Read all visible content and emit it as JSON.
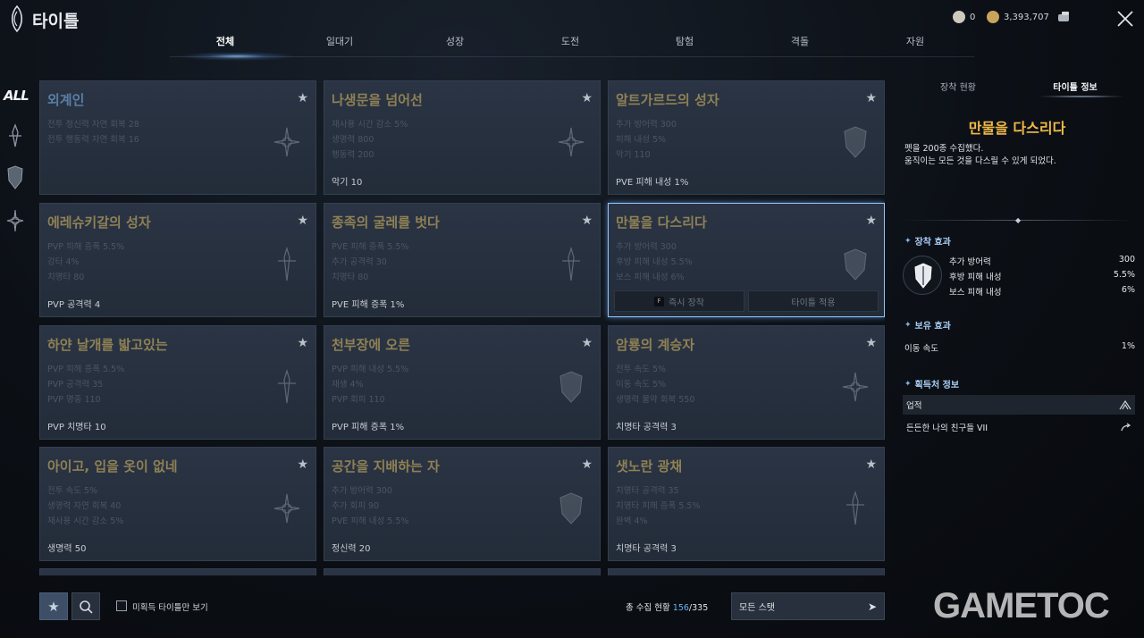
{
  "header": {
    "title": "타이틀",
    "currency_1": "0",
    "currency_2": "3,393,707"
  },
  "tabs": [
    "전체",
    "일대기",
    "성장",
    "도전",
    "탐험",
    "격돌",
    "자원"
  ],
  "active_tab": "전체",
  "rail": {
    "all_label": "ALL"
  },
  "cards": [
    {
      "title": "외계인",
      "stats": [
        "전투 정신력 자연 회복 28",
        "전투 행동력 자연 회복 16"
      ],
      "bonus": ""
    },
    {
      "title": "나생문을 넘어선",
      "stats": [
        "재사용 시간 감소 5%",
        "생명력 800",
        "행동력 200"
      ],
      "bonus": "악기 10"
    },
    {
      "title": "알트가르드의 성자",
      "stats": [
        "추가 방어력 300",
        "피해 내성 5%",
        "악기 110"
      ],
      "bonus": "PVE 피해 내성 1%"
    },
    {
      "title": "에레슈키갈의 성자",
      "stats": [
        "PVP 피해 증폭 5.5%",
        "강타 4%",
        "치명타 80"
      ],
      "bonus": "PVP 공격력 4"
    },
    {
      "title": "종족의 굴레를 벗다",
      "stats": [
        "PVE 피해 증폭 5.5%",
        "추가 공격력 30",
        "치명타 80"
      ],
      "bonus": "PVE 피해 증폭 1%"
    },
    {
      "title": "만물을 다스리다",
      "stats": [
        "추가 방어력 300",
        "후방 피해 내성 5.5%",
        "보스 피해 내성 6%"
      ],
      "bonus": ""
    },
    {
      "title": "하얀 날개를 밟고있는",
      "stats": [
        "PVP 피해 증폭 5.5%",
        "PVP 공격력 35",
        "PVP 명중 110"
      ],
      "bonus": "PVP 치명타 10"
    },
    {
      "title": "천부장에 오른",
      "stats": [
        "PVP 피해 내성 5.5%",
        "재생 4%",
        "PVP 회피 110"
      ],
      "bonus": "PVP 피해 증폭 1%"
    },
    {
      "title": "암룡의 계승자",
      "stats": [
        "전투 속도 5%",
        "이동 속도 5%",
        "생명력 물약 회복 550"
      ],
      "bonus": "치명타 공격력 3"
    },
    {
      "title": "아이고, 입을 옷이 없네",
      "stats": [
        "전투 속도 5%",
        "생명력 자연 회복 40",
        "재사용 시간 감소 5%"
      ],
      "bonus": "생명력 50"
    },
    {
      "title": "공간을 지배하는 자",
      "stats": [
        "추가 방어력 300",
        "추가 회피 90",
        "PVE 피해 내성 5.5%"
      ],
      "bonus": "정신력 20"
    },
    {
      "title": "샛노란 광채",
      "stats": [
        "치명타 공격력 35",
        "치명타 피해 증폭 5.5%",
        "완벽 4%"
      ],
      "bonus": "치명타 공격력 3"
    }
  ],
  "selected_card_buttons": {
    "quick_equip_key": "F",
    "quick_equip": "즉시 장착",
    "apply": "타이틀 적용"
  },
  "panel": {
    "tabs": [
      "장착 현황",
      "타이틀 정보"
    ],
    "active_tab": "타이틀 정보",
    "title": "만물을 다스리다",
    "desc_line1": "펫을 200종 수집했다.",
    "desc_line2": "움직이는 모든 것을 다스릴 수 있게 되었다.",
    "equip_header": "장착 효과",
    "equip_effects": [
      {
        "name": "추가 방어력",
        "value": "300"
      },
      {
        "name": "후방 피해 내성",
        "value": "5.5%"
      },
      {
        "name": "보스 피해 내성",
        "value": "6%"
      }
    ],
    "hold_header": "보유 효과",
    "hold_effects": [
      {
        "name": "이동 속도",
        "value": "1%"
      }
    ],
    "source_header": "획득처 정보",
    "sources": [
      "업적",
      "든든한 나의 친구들 VII"
    ]
  },
  "footer": {
    "unowned_only": "미획득 타이틀만 보기",
    "collect_label": "총 수집 현황",
    "collect_count": "156",
    "collect_total": "/335",
    "all_stats": "모든 스탯"
  },
  "watermark": "GAMETOC",
  "colors": {
    "accent_gold": "#f0b94a",
    "accent_blue": "#6ab0f3",
    "card_bg": "#2a3444",
    "selected_border": "#8fc7ff"
  }
}
